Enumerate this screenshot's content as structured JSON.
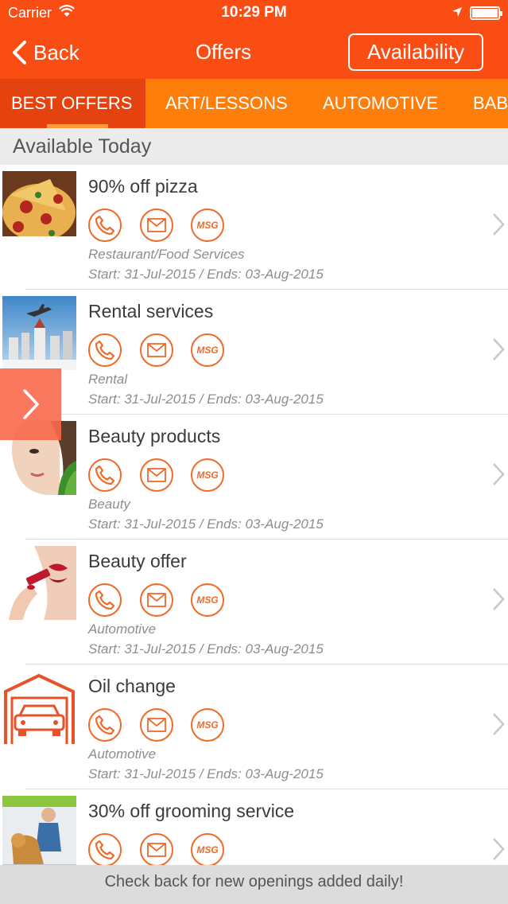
{
  "status": {
    "carrier": "Carrier",
    "time": "10:29 PM"
  },
  "nav": {
    "back_label": "Back",
    "title": "Offers",
    "availability_label": "Availability"
  },
  "tabs": [
    {
      "label": "BEST OFFERS",
      "active": true
    },
    {
      "label": "ART/LESSONS",
      "active": false
    },
    {
      "label": "AUTOMOTIVE",
      "active": false
    },
    {
      "label": "BABY",
      "active": false
    }
  ],
  "section_title": "Available Today",
  "offers": [
    {
      "title": "90% off pizza",
      "category": "Restaurant/Food Services",
      "dates": "Start: 31-Jul-2015 / Ends: 03-Aug-2015",
      "image": "pizza-image",
      "msg_label": "MSG"
    },
    {
      "title": "Rental services",
      "category": "Rental",
      "dates": "Start: 31-Jul-2015 / Ends: 03-Aug-2015",
      "image": "travel-image",
      "msg_label": "MSG"
    },
    {
      "title": "Beauty products",
      "category": "Beauty",
      "dates": "Start: 31-Jul-2015 / Ends: 03-Aug-2015",
      "image": "face-image",
      "msg_label": "MSG"
    },
    {
      "title": "Beauty offer",
      "category": "Automotive",
      "dates": "Start: 31-Jul-2015 / Ends: 03-Aug-2015",
      "image": "lipstick-image",
      "msg_label": "MSG"
    },
    {
      "title": "Oil change",
      "category": "Automotive",
      "dates": "Start: 31-Jul-2015 / Ends: 03-Aug-2015",
      "image": "garage-car-icon",
      "msg_label": "MSG"
    },
    {
      "title": "30% off grooming service",
      "category": "",
      "dates": "",
      "image": "dog-grooming-image",
      "msg_label": "MSG"
    }
  ],
  "footer": "Check back for new openings added daily!",
  "colors": {
    "nav_bg": "#fa4d14",
    "tabs_bg": "#fe7e0c",
    "tab_active_bg": "#e4420f",
    "accent": "#f06a2a"
  }
}
